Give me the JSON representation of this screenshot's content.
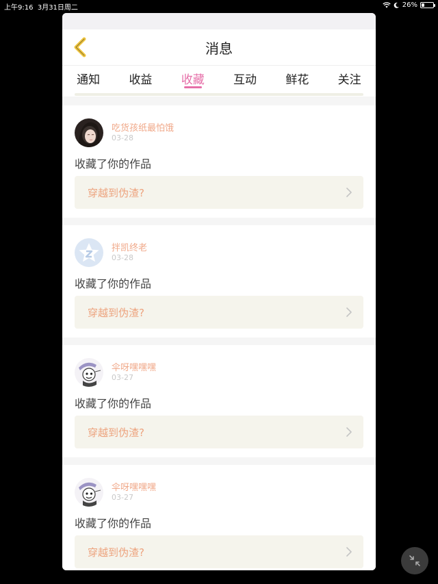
{
  "status_bar": {
    "time": "上午9:16",
    "date": "3月31日周二",
    "battery": "26%",
    "battery_level": 0.26
  },
  "header": {
    "title": "消息"
  },
  "tabs": [
    {
      "label": "通知",
      "active": false
    },
    {
      "label": "收益",
      "active": false
    },
    {
      "label": "收藏",
      "active": true
    },
    {
      "label": "互动",
      "active": false
    },
    {
      "label": "鲜花",
      "active": false
    },
    {
      "label": "关注",
      "active": false
    }
  ],
  "messages": [
    {
      "user": "吃货孩纸最怕饿",
      "date": "03-28",
      "action": "收藏了你的作品",
      "work": "穿越到伪渣?",
      "avatar": "photo-avatar"
    },
    {
      "user": "拌凯终老",
      "date": "03-28",
      "action": "收藏了你的作品",
      "work": "穿越到伪渣?",
      "avatar": "default-star-avatar"
    },
    {
      "user": "伞呀嘿嘿嘿",
      "date": "03-27",
      "action": "收藏了你的作品",
      "work": "穿越到伪渣?",
      "avatar": "cartoon-avatar"
    },
    {
      "user": "伞呀嘿嘿嘿",
      "date": "03-27",
      "action": "收藏了你的作品",
      "work": "穿越到伪渣?",
      "avatar": "cartoon-avatar"
    }
  ],
  "colors": {
    "accent": "#e66fa8",
    "username": "#f0a98a",
    "work_title": "#eda37e",
    "work_bar_bg": "#f5f4ec"
  }
}
